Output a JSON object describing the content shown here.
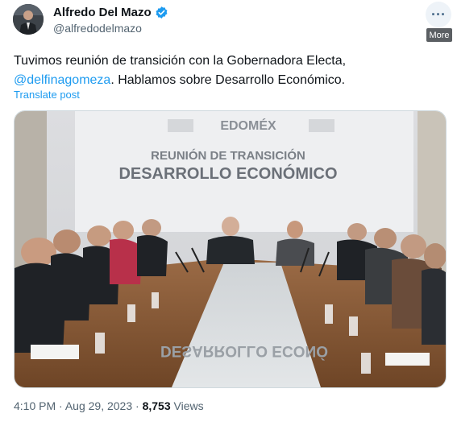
{
  "author": {
    "name": "Alfredo Del Mazo",
    "handle": "@alfredodelmazo",
    "verified": true,
    "verified_color": "#1d9bf0"
  },
  "more_button": {
    "icon": "more-horizontal-icon",
    "tooltip": "More"
  },
  "tweet": {
    "text_before": "Tuvimos reunión de transición con la Gobernadora Electa,",
    "mention": "@delfinagomeza",
    "text_after": ". Hablamos sobre Desarrollo Económico.",
    "translate_label": "Translate post"
  },
  "photo": {
    "logo": "EDOMÉX",
    "banner_line1": "REUNIÓN DE TRANSICIÓN",
    "banner_line2": "DESARROLLO ECONÓMICO",
    "reflection": "DESARROLLO ECONÓ"
  },
  "meta": {
    "time": "4:10 PM",
    "separator": "·",
    "date": "Aug 29, 2023",
    "views_count": "8,753",
    "views_label": "Views"
  }
}
